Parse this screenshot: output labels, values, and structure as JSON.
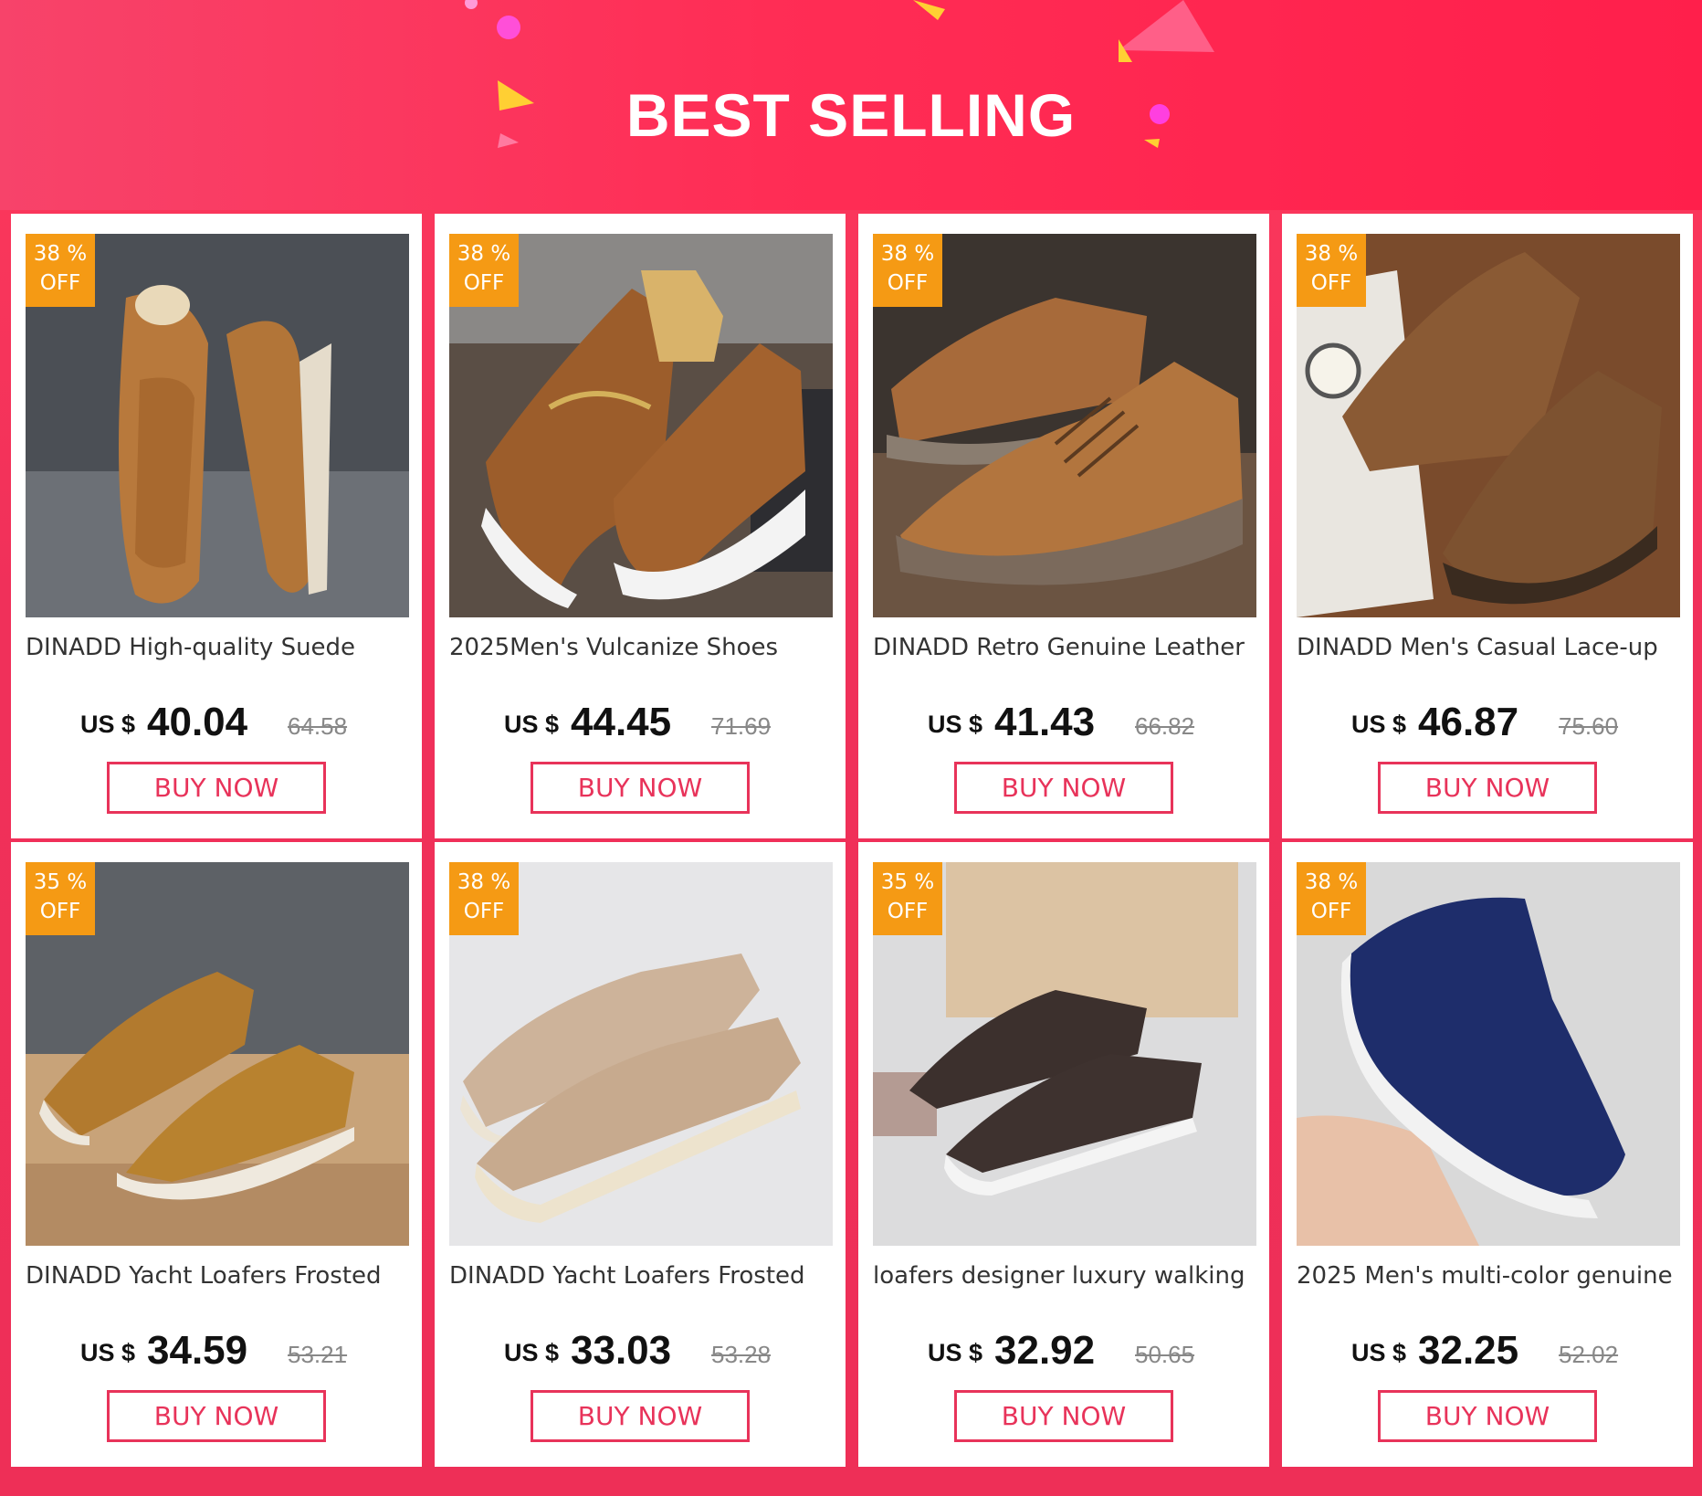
{
  "header": {
    "title": "BEST SELLING"
  },
  "colors": {
    "accent": "#e8335a",
    "badge": "#f59a14",
    "background": "#f0305a"
  },
  "products": [
    {
      "discount": "38 %",
      "off": "OFF",
      "name": "DINADD High-quality Suede",
      "currency": "US $",
      "price": "40.04",
      "original": "64.58",
      "button": "BUY NOW",
      "image": "tan-suede-loafer"
    },
    {
      "discount": "38 %",
      "off": "OFF",
      "name": "2025Men's Vulcanize Shoes",
      "currency": "US $",
      "price": "44.45",
      "original": "71.69",
      "button": "BUY NOW",
      "image": "brown-horsebit-sneaker-loafer"
    },
    {
      "discount": "38 %",
      "off": "OFF",
      "name": "DINADD Retro Genuine Leather",
      "currency": "US $",
      "price": "41.43",
      "original": "66.82",
      "button": "BUY NOW",
      "image": "tan-suede-derby"
    },
    {
      "discount": "38 %",
      "off": "OFF",
      "name": "DINADD Men's Casual Lace-up",
      "currency": "US $",
      "price": "46.87",
      "original": "75.60",
      "button": "BUY NOW",
      "image": "brown-suede-lace-up"
    },
    {
      "discount": "35 %",
      "off": "OFF",
      "name": "DINADD Yacht Loafers Frosted",
      "currency": "US $",
      "price": "34.59",
      "original": "53.21",
      "button": "BUY NOW",
      "image": "camel-suede-loafer"
    },
    {
      "discount": "38 %",
      "off": "OFF",
      "name": "DINADD Yacht Loafers Frosted",
      "currency": "US $",
      "price": "33.03",
      "original": "53.28",
      "button": "BUY NOW",
      "image": "beige-suede-loafer"
    },
    {
      "discount": "35 %",
      "off": "OFF",
      "name": "loafers designer luxury walking",
      "currency": "US $",
      "price": "32.92",
      "original": "50.65",
      "button": "BUY NOW",
      "image": "dark-brown-suede-loafer"
    },
    {
      "discount": "38 %",
      "off": "OFF",
      "name": "2025 Men's multi-color genuine",
      "currency": "US $",
      "price": "32.25",
      "original": "52.02",
      "button": "BUY NOW",
      "image": "navy-suede-loafer"
    }
  ]
}
